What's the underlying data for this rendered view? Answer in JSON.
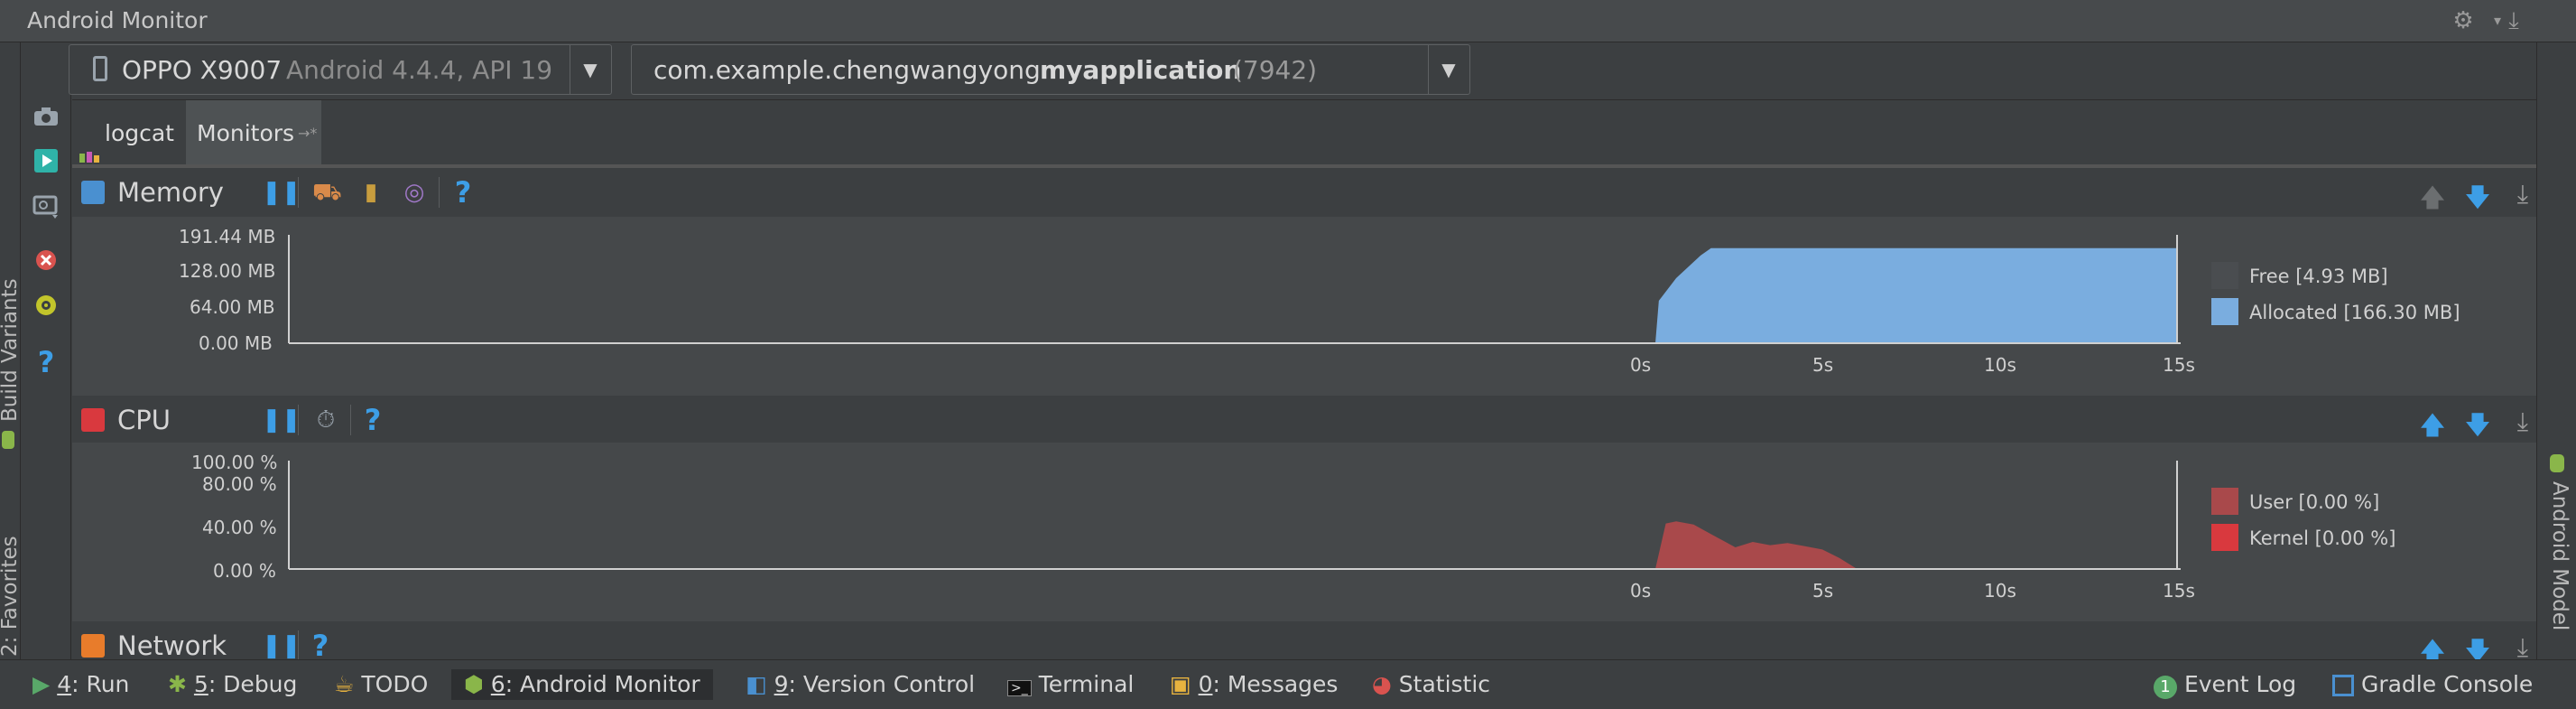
{
  "window": {
    "title": "Android Monitor"
  },
  "left_strip": {
    "build_variants": "Build Variants",
    "favorites": "2: Favorites"
  },
  "right_strip": {
    "android_model": "Android Model"
  },
  "device_selector": {
    "device_name": "OPPO X9007",
    "device_os": "Android 4.4.4, API 19"
  },
  "process_selector": {
    "package_prefix": "com.example.chengwangyong.",
    "package_app": "myapplication",
    "pid": "(7942)"
  },
  "tabs": [
    {
      "label": "logcat"
    },
    {
      "label": "Monitors",
      "suffix": "→*"
    }
  ],
  "memory": {
    "title": "Memory",
    "legend": [
      {
        "label": "Free [4.93 MB]",
        "color": "#4a4d50"
      },
      {
        "label": "Allocated [166.30 MB]",
        "color": "#7aaddf"
      }
    ],
    "y_ticks": [
      "191.44 MB",
      "128.00 MB",
      "64.00 MB",
      "0.00 MB"
    ],
    "x_ticks": [
      "0s",
      "5s",
      "10s",
      "15s"
    ]
  },
  "cpu": {
    "title": "CPU",
    "legend": [
      {
        "label": "User [0.00 %]",
        "color": "#a9494b"
      },
      {
        "label": "Kernel [0.00 %]",
        "color": "#d9393e"
      }
    ],
    "y_ticks": [
      "100.00 %",
      "80.00 %",
      "40.00 %",
      "0.00 %"
    ],
    "x_ticks": [
      "0s",
      "5s",
      "10s",
      "15s"
    ]
  },
  "network": {
    "title": "Network"
  },
  "bottom_tabs": [
    {
      "num": "4",
      "label": ": Run"
    },
    {
      "num": "5",
      "label": ": Debug"
    },
    {
      "num": "",
      "label": "TODO"
    },
    {
      "num": "6",
      "label": ": Android Monitor"
    },
    {
      "num": "9",
      "label": ": Version Control"
    },
    {
      "num": "",
      "label": "Terminal"
    },
    {
      "num": "0",
      "label": ": Messages"
    },
    {
      "num": "",
      "label": "Statistic"
    }
  ],
  "bottom_right": {
    "event_log_badge": "1",
    "event_log": "Event Log",
    "gradle_console": "Gradle Console"
  },
  "chart_data": [
    {
      "type": "area",
      "title": "Memory",
      "x_ticks": [
        "0s",
        "5s",
        "10s",
        "15s"
      ],
      "xlim": [
        0,
        15
      ],
      "ylim": [
        0,
        191.44
      ],
      "y_ticks": [
        "0.00 MB",
        "64.00 MB",
        "128.00 MB",
        "191.44 MB"
      ],
      "series": [
        {
          "name": "Allocated [166.30 MB]",
          "x": [
            0,
            0.1,
            0.6,
            1.3,
            1.6,
            3,
            6,
            10,
            15
          ],
          "y": [
            0,
            75,
            115,
            155,
            168,
            168,
            168,
            168,
            168
          ]
        }
      ]
    },
    {
      "type": "area",
      "title": "CPU",
      "x_ticks": [
        "0s",
        "5s",
        "10s",
        "15s"
      ],
      "xlim": [
        0,
        15
      ],
      "ylim": [
        0,
        100
      ],
      "y_ticks": [
        "0.00 %",
        "40.00 %",
        "80.00 %",
        "100.00 %"
      ],
      "series": [
        {
          "name": "User [0.00 %]",
          "x": [
            0,
            0.3,
            0.6,
            1.1,
            1.5,
            2.3,
            2.8,
            3.3,
            3.8,
            4.3,
            4.8,
            5.3,
            5.8
          ],
          "y": [
            0,
            42,
            44,
            41,
            34,
            20,
            25,
            22,
            24,
            21,
            18,
            10,
            0
          ]
        },
        {
          "name": "Kernel [0.00 %]",
          "x": [
            0,
            0.4,
            0.8,
            1.3,
            2,
            2.5,
            3,
            3.5,
            4,
            4.5,
            5,
            5.5,
            5.8
          ],
          "y": [
            0,
            8,
            12,
            14,
            12,
            16,
            13,
            15,
            14,
            12,
            10,
            5,
            0
          ]
        }
      ]
    }
  ]
}
